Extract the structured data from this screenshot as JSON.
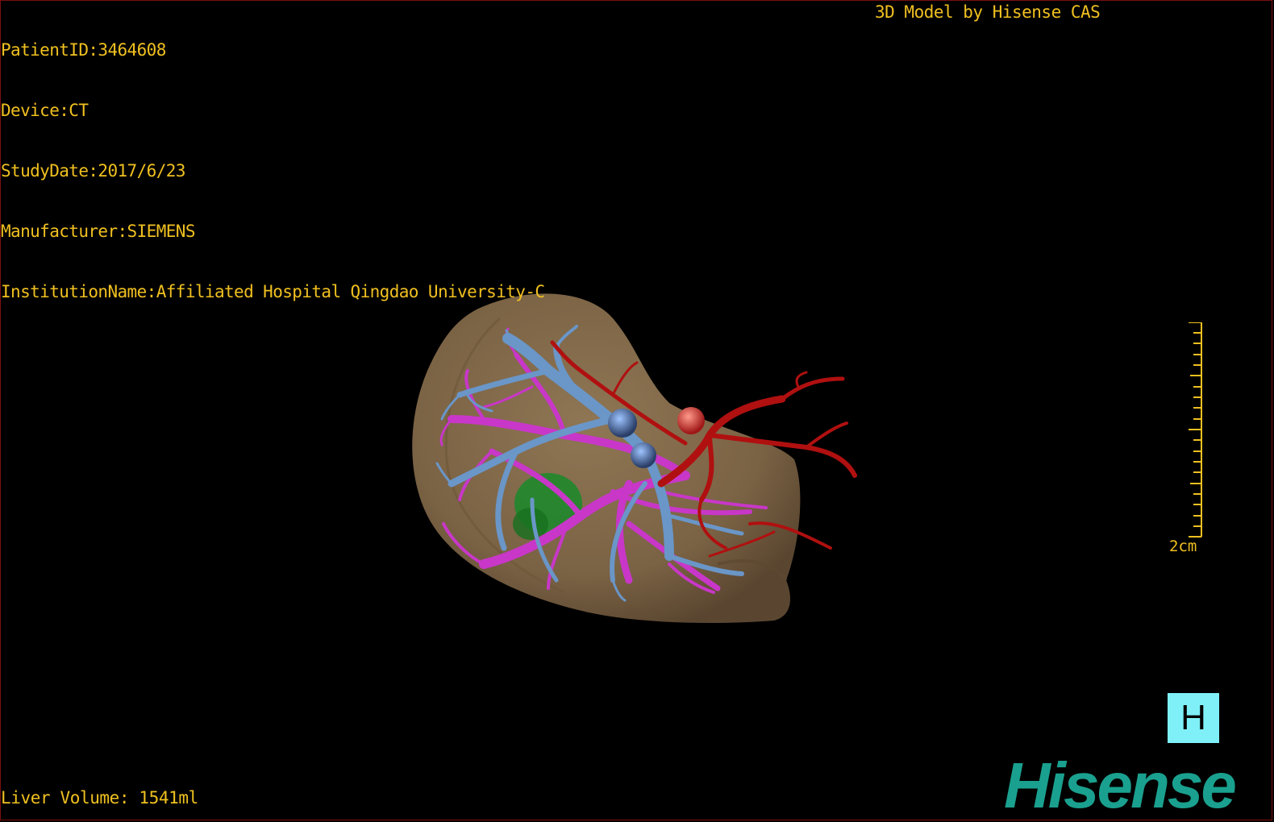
{
  "viewer": {
    "patient_id": "PatientID:3464608",
    "device": "Device:CT",
    "study_date": "StudyDate:2017/6/23",
    "manufacturer": "Manufacturer:SIEMENS",
    "institution": "InstitutionName:Affiliated Hospital Qingdao University-C",
    "model_credit": "3D Model by Hisense CAS",
    "liver_volume": "Liver Volume: 1541ml",
    "scale_label": "2cm",
    "orientation_label": "H",
    "logo_text": "Hisense"
  },
  "colors": {
    "text": "#f0c020",
    "background": "#000000",
    "liver": "#8a7150",
    "portal_vein": "#6a96c8",
    "hepatic_vein": "#c837c8",
    "artery": "#b01010",
    "tumor": "#1a8a2a",
    "logo": "#1aa08e",
    "orientation_box": "#7ff0f8"
  }
}
